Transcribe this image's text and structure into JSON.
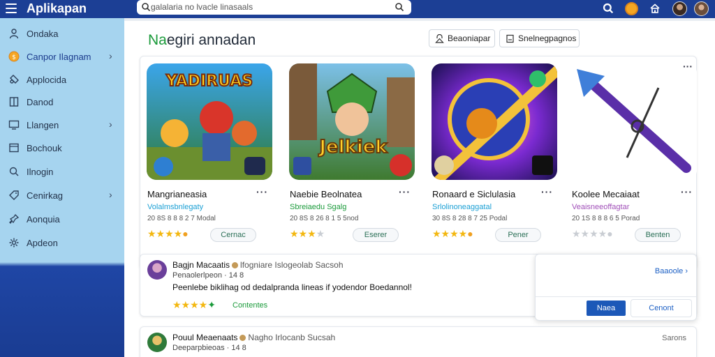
{
  "header": {
    "app_title": "Aplikapan",
    "search_placeholder": "galalaria no lvacle linasaals"
  },
  "sidebar": {
    "items": [
      {
        "label": "Ondaka",
        "icon": "person-icon",
        "chevron": false
      },
      {
        "label": "Canpor Ilagnam",
        "icon": "coin-icon",
        "chevron": true
      },
      {
        "label": "Applocida",
        "icon": "puzzle-icon",
        "chevron": false
      },
      {
        "label": "Danod",
        "icon": "bookmark-icon",
        "chevron": false
      },
      {
        "label": "Llangen",
        "icon": "monitor-icon",
        "chevron": true
      },
      {
        "label": "Bochouk",
        "icon": "book-icon",
        "chevron": false
      },
      {
        "label": "Ilnogin",
        "icon": "search-person-icon",
        "chevron": false
      },
      {
        "label": "Cenirkag",
        "icon": "tag-icon",
        "chevron": true
      },
      {
        "label": "Aonquia",
        "icon": "pin-icon",
        "chevron": false
      },
      {
        "label": "Apdeon",
        "icon": "settings-icon",
        "chevron": false
      }
    ]
  },
  "main": {
    "title_accent": "Na",
    "title_rest": "egiri annadan",
    "toolbar": {
      "btn1_label": "Beaoniapar",
      "btn2_label": "Snelnegpagnos"
    },
    "cards": [
      {
        "title": "Mangrianeasia",
        "subtitle": "Volalmsbnlegaty",
        "meta": "20 8S 8 8 8 2 7 Modal",
        "rating": 4,
        "button": "Cernac",
        "subtitle_color": "#1a9fd4"
      },
      {
        "title": "Naebie Beolnatea",
        "subtitle": "Sbreiaedu Sgalg",
        "meta": "20 8S 8 26 8 1 5 5nod",
        "rating": 3,
        "button": "Eserer",
        "subtitle_color": "#1a9a3a"
      },
      {
        "title": "Ronaard e Siclulasia",
        "subtitle": "Srlolinoneaggatal",
        "meta": "30 8S 8 28 8 7 25 Podal",
        "rating": 4,
        "button": "Pener",
        "subtitle_color": "#1a9fd4"
      },
      {
        "title": "Koolee Mecaiaat",
        "subtitle": "Veaisneeoffagtar",
        "meta": "20 1S 8 8 8 6 5 Porad",
        "rating": 0,
        "button": "Benten",
        "subtitle_color": "#a04fb8"
      }
    ],
    "reviews": [
      {
        "name": "Bagjn Macaatis",
        "tag": "lfogniare Islogeolab",
        "extra": "Sacsoh",
        "meta": "Penaolerlpeon · 14 8",
        "text": "Peenlebe biklihag od dedalpranda lineas if yodendor Boedannol!",
        "rating": 4,
        "link": "Contentes"
      },
      {
        "name": "Pouul Meaenaats",
        "tag": "Nagho Irlocanb",
        "extra": "Sucsah",
        "meta": "Deeparpbieoas · 14 8",
        "text": "",
        "rating": 0,
        "link": "",
        "side": "Sarons"
      }
    ]
  },
  "popup": {
    "link": "Baaoole",
    "primary_label": "Naea",
    "secondary_label": "Cenont"
  },
  "colors": {
    "header_bg": "#1c3f95",
    "sidebar_bg": "#a6d4ef",
    "accent_green": "#1a9a3a",
    "accent_blue": "#1c58b8",
    "star": "#f3b70f"
  }
}
